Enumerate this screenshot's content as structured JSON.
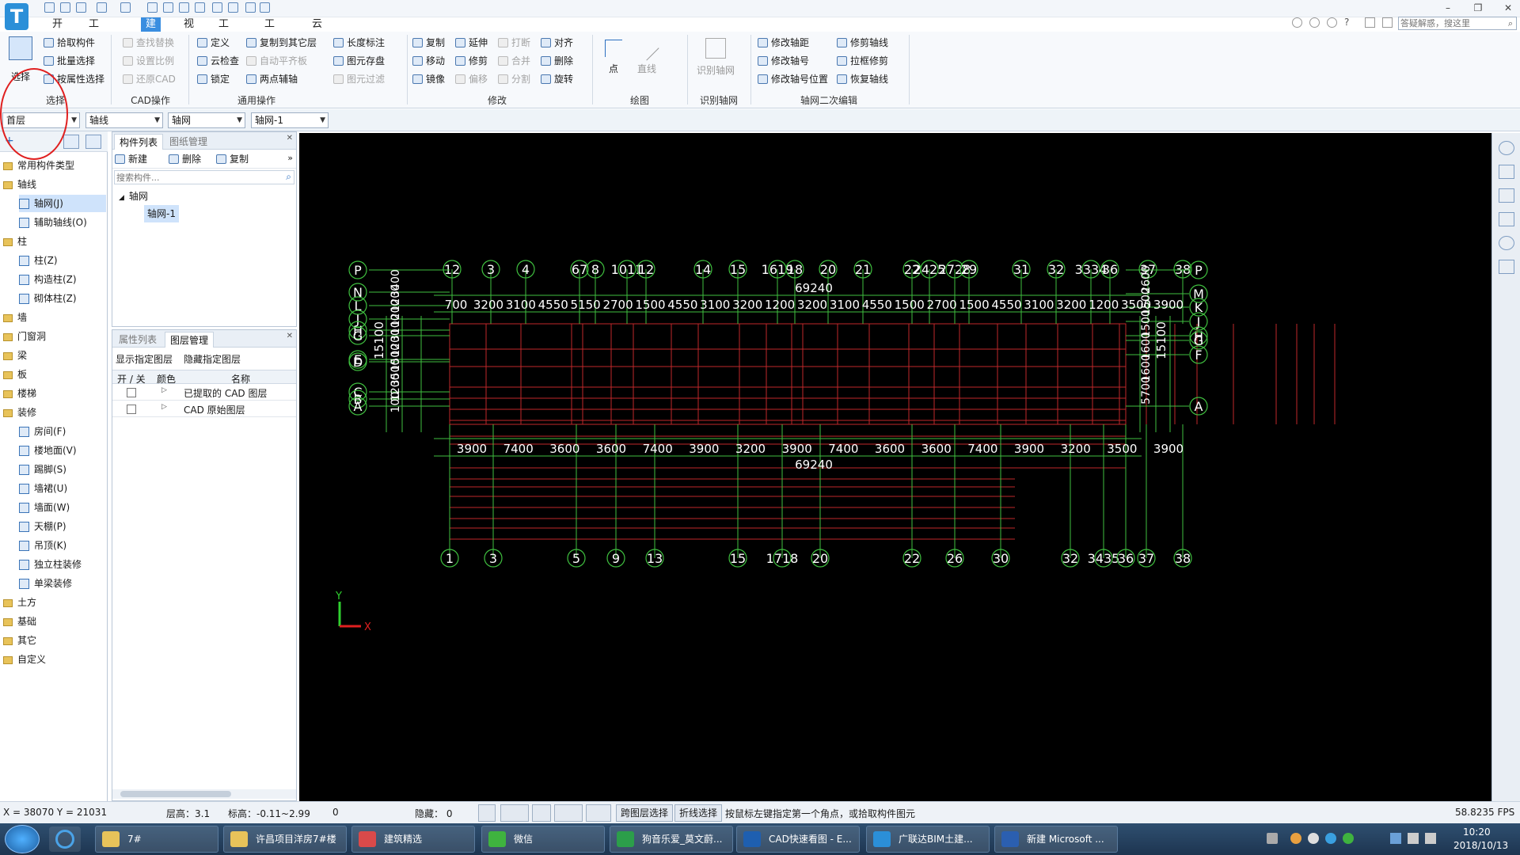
{
  "app": {
    "logo": "T"
  },
  "menubar": [
    "开始",
    "工程设置",
    "建模",
    "视图",
    "工具",
    "工程量",
    "云应用"
  ],
  "active_menu": "建模",
  "search": {
    "placeholder": "答疑解惑，搜这里"
  },
  "ribbon": {
    "select": "选择",
    "groups": {
      "select": [
        "拾取构件",
        "批量选择",
        "按属性选择"
      ],
      "cad": [
        "查找替换",
        "设置比例",
        "还原CAD"
      ],
      "general1": [
        "定义",
        "云检查",
        "锁定"
      ],
      "general2": [
        "复制到其它层",
        "自动平齐板",
        "两点辅轴"
      ],
      "general3": [
        "长度标注",
        "图元存盘",
        "图元过滤"
      ],
      "modify1": [
        "复制",
        "移动",
        "镜像"
      ],
      "modify2": [
        "延伸",
        "修剪",
        "偏移"
      ],
      "modify3": [
        "打断",
        "合并",
        "分割"
      ],
      "modify4": [
        "对齐",
        "删除",
        "旋转"
      ],
      "draw": [
        "点",
        "直线"
      ],
      "identify": "识别轴网",
      "axis1": [
        "修改轴距",
        "修改轴号",
        "修改轴号位置"
      ],
      "axis2": [
        "修剪轴线",
        "拉框修剪",
        "恢复轴线"
      ]
    },
    "group_labels": [
      "选择",
      "CAD操作",
      "通用操作",
      "修改",
      "绘图",
      "识别轴网",
      "轴网二次编辑"
    ]
  },
  "combos": [
    "首层",
    "轴线",
    "轴网",
    "轴网-1"
  ],
  "nav_tree": [
    {
      "t": "常用构件类型",
      "lvl": 0
    },
    {
      "t": "轴线",
      "lvl": 0
    },
    {
      "t": "轴网(J)",
      "lvl": 1,
      "sel": true
    },
    {
      "t": "辅助轴线(O)",
      "lvl": 1
    },
    {
      "t": "柱",
      "lvl": 0
    },
    {
      "t": "柱(Z)",
      "lvl": 1
    },
    {
      "t": "构造柱(Z)",
      "lvl": 1
    },
    {
      "t": "砌体柱(Z)",
      "lvl": 1
    },
    {
      "t": "墙",
      "lvl": 0
    },
    {
      "t": "门窗洞",
      "lvl": 0
    },
    {
      "t": "梁",
      "lvl": 0
    },
    {
      "t": "板",
      "lvl": 0
    },
    {
      "t": "楼梯",
      "lvl": 0
    },
    {
      "t": "装修",
      "lvl": 0
    },
    {
      "t": "房间(F)",
      "lvl": 1
    },
    {
      "t": "楼地面(V)",
      "lvl": 1
    },
    {
      "t": "踢脚(S)",
      "lvl": 1
    },
    {
      "t": "墙裙(U)",
      "lvl": 1
    },
    {
      "t": "墙面(W)",
      "lvl": 1
    },
    {
      "t": "天棚(P)",
      "lvl": 1
    },
    {
      "t": "吊顶(K)",
      "lvl": 1
    },
    {
      "t": "独立柱装修",
      "lvl": 1
    },
    {
      "t": "单梁装修",
      "lvl": 1
    },
    {
      "t": "土方",
      "lvl": 0
    },
    {
      "t": "基础",
      "lvl": 0
    },
    {
      "t": "其它",
      "lvl": 0
    },
    {
      "t": "自定义",
      "lvl": 0
    }
  ],
  "panel1": {
    "tabs": [
      "构件列表",
      "图纸管理"
    ],
    "tools": [
      "新建",
      "删除",
      "复制"
    ],
    "search_placeholder": "搜索构件...",
    "root": "轴网",
    "item": "轴网-1"
  },
  "panel2": {
    "tabs": [
      "属性列表",
      "图层管理"
    ],
    "actions": [
      "显示指定图层",
      "隐藏指定图层"
    ],
    "headers": [
      "开 / 关",
      "颜色",
      "名称"
    ],
    "rows": [
      "已提取的 CAD 图层",
      "CAD 原始图层"
    ]
  },
  "cad": {
    "top_axes": [
      "12",
      "3",
      "4",
      "67",
      "8",
      "1011",
      "12",
      "14",
      "15",
      "1619",
      "18",
      "20",
      "21",
      "22",
      "2425",
      "2728",
      "29",
      "31",
      "32",
      "3334",
      "36",
      "37",
      "38"
    ],
    "top_dims": [
      "700",
      "3200",
      "3100",
      "4550",
      "5150",
      "2700",
      "1500",
      "4550",
      "3100",
      "3200",
      "1200",
      "3200",
      "3100",
      "4550",
      "1500",
      "2700",
      "1500",
      "4550",
      "3100",
      "3200",
      "1200",
      "3500",
      "3900"
    ],
    "top_total": "69240",
    "bottom_axes": [
      "1",
      "3",
      "5",
      "9",
      "13",
      "15",
      "1718",
      "20",
      "22",
      "26",
      "30",
      "32",
      "3435",
      "36",
      "37",
      "38"
    ],
    "bottom_dims": [
      "3900",
      "7400",
      "3600",
      "3600",
      "7400",
      "3900",
      "3200",
      "3900",
      "7400",
      "3600",
      "3600",
      "7400",
      "3900",
      "3200",
      "3500",
      "3900"
    ],
    "bottom_total": "69240",
    "left_axes": [
      "P",
      "N",
      "L",
      "J",
      "H",
      "G",
      "E",
      "D",
      "C",
      "B",
      "A"
    ],
    "left_dims": [
      "3400",
      "1200",
      "1200",
      "3100",
      "1200",
      "1500",
      "3500",
      "1200",
      "100"
    ],
    "left_total": "15100",
    "right_axes": [
      "P",
      "M",
      "K",
      "J",
      "H",
      "G",
      "F",
      "A"
    ],
    "right_dims": [
      "2600",
      "1500",
      "1500",
      "1600",
      "1600",
      "5700"
    ],
    "right_total": "15100",
    "ucs": {
      "x": "X",
      "y": "Y"
    }
  },
  "status": {
    "coords": "X = 38070 Y = 21031",
    "floor_height": "层高：3.1",
    "elevation": "标高：-0.11~2.99",
    "zero": "0",
    "hidden": "隐藏： 0",
    "btn1": "跨图层选择",
    "btn2": "折线选择",
    "hint": "按鼠标左键指定第一个角点，或拾取构件图元",
    "fps": "58.8235 FPS"
  },
  "taskbar": [
    {
      "label": "7#",
      "color": "#e8c35a"
    },
    {
      "label": "许昌项目洋房7#楼",
      "color": "#e8c35a"
    },
    {
      "label": "建筑精选",
      "color": "#d94a4a"
    },
    {
      "label": "微信",
      "color": "#3fb33f"
    },
    {
      "label": "狗音乐爱_莫文蔚...",
      "color": "#2c9e4a"
    },
    {
      "label": "CAD快速看图 - E...",
      "color": "#1e5fb0"
    },
    {
      "label": "广联达BIM土建...",
      "color": "#2b8fd8"
    },
    {
      "label": "新建 Microsoft ...",
      "color": "#2b5fb0"
    }
  ],
  "clock": {
    "time": "10:20",
    "date": "2018/10/13"
  }
}
